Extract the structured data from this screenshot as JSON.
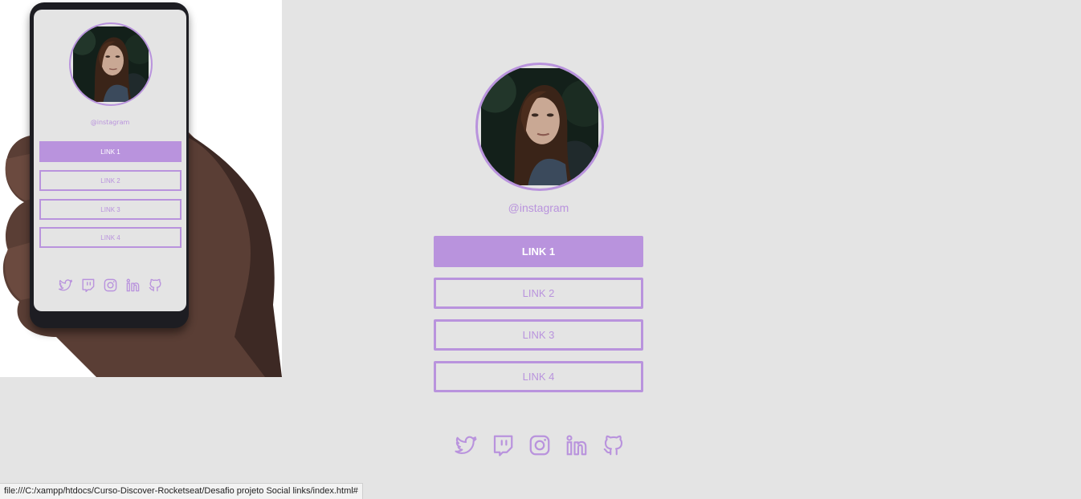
{
  "mockup": {
    "handle": "@instagram",
    "links": [
      "LINK 1",
      "LINK 2",
      "LINK 3",
      "LINK 4"
    ]
  },
  "profile": {
    "handle": "@instagram"
  },
  "links": [
    {
      "label": "LINK 1"
    },
    {
      "label": "LINK 2"
    },
    {
      "label": "LINK 3"
    },
    {
      "label": "LINK 4"
    }
  ],
  "social_icons": [
    "twitter-icon",
    "twitch-icon",
    "instagram-icon",
    "linkedin-icon",
    "github-icon"
  ],
  "status_url": "file:///C:/xampp/htdocs/Curso-Discover-Rocketseat/Desafio projeto Social links/index.html#",
  "colors": {
    "accent": "#b993dd",
    "background": "#e4e4e4",
    "button_text_filled": "#ffffff"
  }
}
